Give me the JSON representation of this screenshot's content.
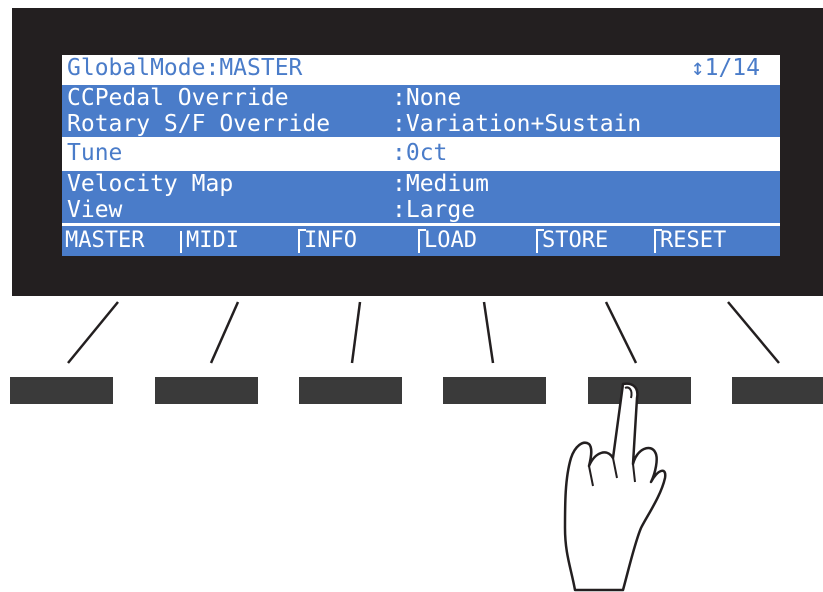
{
  "screen": {
    "header": {
      "title": "GlobalMode:MASTER",
      "page": "↕1/14"
    },
    "params": [
      {
        "name": "CCPedal Override",
        "value": ":None",
        "highlighted": true
      },
      {
        "name": "Rotary S/F Override",
        "value": ":Variation+Sustain",
        "highlighted": true
      },
      {
        "name": "Tune",
        "value": ":0ct",
        "highlighted": false
      },
      {
        "name": "Velocity Map",
        "value": ":Medium",
        "highlighted": true
      },
      {
        "name": "View",
        "value": ":Large",
        "highlighted": true
      }
    ],
    "soft_tabs": [
      "MASTER",
      "MIDI",
      "INFO",
      "LOAD",
      "STORE",
      "RESET"
    ]
  },
  "colors": {
    "lcd_blue": "#4a7cc9",
    "bezel": "#231f20",
    "button": "#3a3a3a"
  },
  "icons": {
    "pointer": "pointing-hand-icon"
  },
  "pressed_button": "STORE"
}
